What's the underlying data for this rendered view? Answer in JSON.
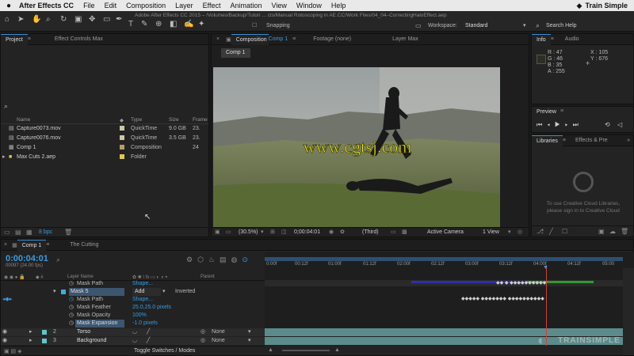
{
  "menubar": {
    "apple": "",
    "app": "After Effects CC",
    "items": [
      "File",
      "Edit",
      "Composition",
      "Layer",
      "Effect",
      "Animation",
      "View",
      "Window",
      "Help"
    ],
    "brand": "Train Simple"
  },
  "titlebar": {
    "text": "Adobe After Effects CC 2015 – /Volumes/Backup/Tutori ... cts/Manual Rotoscoping in AE.CC/Work Files/04_04–CorrectingHaloEffect.aep"
  },
  "toolbar": {
    "snapping": "Snapping",
    "workspace_label": "Workspace:",
    "workspace_value": "Standard",
    "search": "Search Help"
  },
  "project": {
    "tab": "Project",
    "tab2": "Effect Controls Max",
    "search_icon": "⌕",
    "columns": [
      "Name",
      "Type",
      "Size",
      "Frame"
    ],
    "items": [
      {
        "name": "Capture0073.mov",
        "type": "QuickTime",
        "size": "9.0 GB",
        "frame": "23.",
        "color": "#c9c9a6"
      },
      {
        "name": "Capture0076.mov",
        "type": "QuickTime",
        "size": "3.5 GB",
        "frame": "23.",
        "color": "#c9c9a6"
      },
      {
        "name": "Comp 1",
        "type": "Composition",
        "size": "",
        "frame": "24",
        "color": "#b89c6c"
      },
      {
        "name": "Max Cuts 2.aep",
        "type": "Folder",
        "size": "",
        "frame": "",
        "color": "#e0c94a"
      }
    ],
    "bpc": "8 bpc"
  },
  "viewer": {
    "tab_comp": "Composition",
    "tab_comp_name": "Comp 1",
    "tab_footage": "Footage (none)",
    "tab_layer": "Layer Max",
    "breadcrumb": "Comp 1",
    "watermark": "www.cgtsj.com",
    "zoom": "(30.5%)",
    "time": "0;00:04:01",
    "quality": "(Third)",
    "camera": "Active Camera",
    "views": "1 View"
  },
  "info": {
    "tab": "Info",
    "tab2": "Audio",
    "r": "R : 47",
    "g": "G : 46",
    "b": "B : 35",
    "a": "A : 255",
    "x": "X : 105",
    "y": "Y : 676"
  },
  "preview": {
    "title": "Preview"
  },
  "libraries": {
    "tab": "Libraries",
    "tab2": "Effects & Pre",
    "msg1": "To use Creative Cloud Libraries,",
    "msg2": "please sign in to Creative Cloud"
  },
  "timeline": {
    "tab": "Comp 1",
    "tab2": "The Cutting",
    "timecode": "0:00:04:01",
    "fps": "00097 (24.00 fps)",
    "col_layer": "Layer Name",
    "col_parent": "Parent",
    "ticks": [
      "0:00f",
      "00:12f",
      "01:00f",
      "01:12f",
      "02:00f",
      "02:12f",
      "03:00f",
      "03:12f",
      "04:00f",
      "04:12f",
      "05:00"
    ],
    "mask_path_top": "Mask Path",
    "mask_path_top_val": "Shape...",
    "mask5": "Mask 5",
    "mask5_mode": "Add",
    "mask5_inv": "Inverted",
    "mask_path": "Mask Path",
    "mask_path_val": "Shape...",
    "feather": "Mask Feather",
    "feather_val": "25.0,25.0 pixels",
    "opacity": "Mask Opacity",
    "opacity_val": "100%",
    "expansion": "Mask Expansion",
    "expansion_val": "-1.0 pixels",
    "layer2": "Torso",
    "layer2_num": "2",
    "layer3": "Background",
    "layer3_num": "3",
    "none": "None",
    "toggle": "Toggle Switches / Modes"
  },
  "trainsimple": "TRAINSIMPLE"
}
